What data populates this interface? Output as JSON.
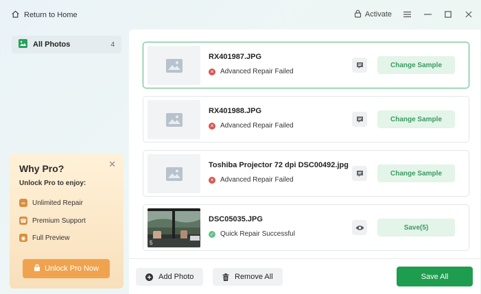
{
  "topbar": {
    "back_label": "Return to Home",
    "activate_label": "Activate"
  },
  "sidebar": {
    "items": [
      {
        "label": "All Photos",
        "count": "4"
      }
    ]
  },
  "promo": {
    "title": "Why Pro?",
    "subtitle": "Unlock Pro to enjoy:",
    "features": [
      "Unlimited Repair",
      "Premium Support",
      "Full Preview"
    ],
    "button_label": "Unlock Pro Now"
  },
  "photos": [
    {
      "name": "RX401987.JPG",
      "status": "Advanced Repair Failed",
      "state": "failed",
      "action": "Change Sample",
      "action_icon": "message-icon"
    },
    {
      "name": "RX401988.JPG",
      "status": "Advanced Repair Failed",
      "state": "failed",
      "action": "Change Sample",
      "action_icon": "message-icon"
    },
    {
      "name": "Toshiba Projector 72 dpi DSC00492.jpg",
      "status": "Advanced Repair Failed",
      "state": "failed",
      "action": "Change Sample",
      "action_icon": "message-icon"
    },
    {
      "name": "DSC05035.JPG",
      "status": "Quick Repair Successful",
      "state": "success",
      "action": "Save(5)",
      "action_icon": "eye-icon",
      "thumb_badge": "5"
    }
  ],
  "bottom": {
    "add_label": "Add Photo",
    "remove_label": "Remove All",
    "save_all_label": "Save All"
  },
  "colors": {
    "accent_green": "#1f9d4f",
    "promo_orange": "#f0a34e",
    "error_red": "#d9534f"
  }
}
